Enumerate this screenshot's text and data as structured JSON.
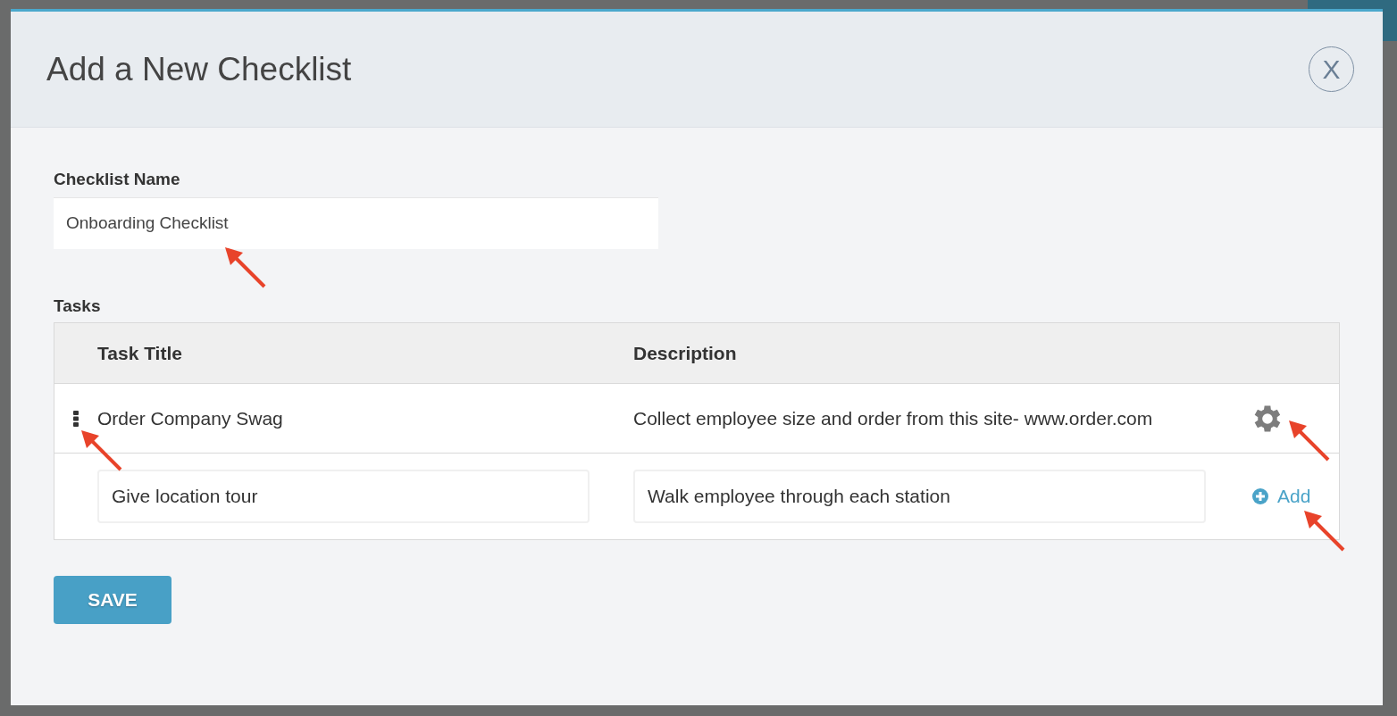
{
  "dialog": {
    "title": "Add a New Checklist",
    "close_label": "X"
  },
  "checklist_name": {
    "label": "Checklist Name",
    "value": "Onboarding Checklist",
    "annotated": true
  },
  "tasks": {
    "label": "Tasks",
    "columns": [
      "Task Title",
      "Description"
    ],
    "rows": [
      {
        "kind": "saved",
        "title": "Order Company Swag",
        "description": "Collect employee size and order from this site- www.order.com",
        "handle_annotated": true,
        "gear_annotated": true
      }
    ],
    "new_row": {
      "title": "Give location tour",
      "description": "Walk employee through each station",
      "add_label": "Add",
      "annotated": true
    }
  },
  "save_label": "SAVE"
}
